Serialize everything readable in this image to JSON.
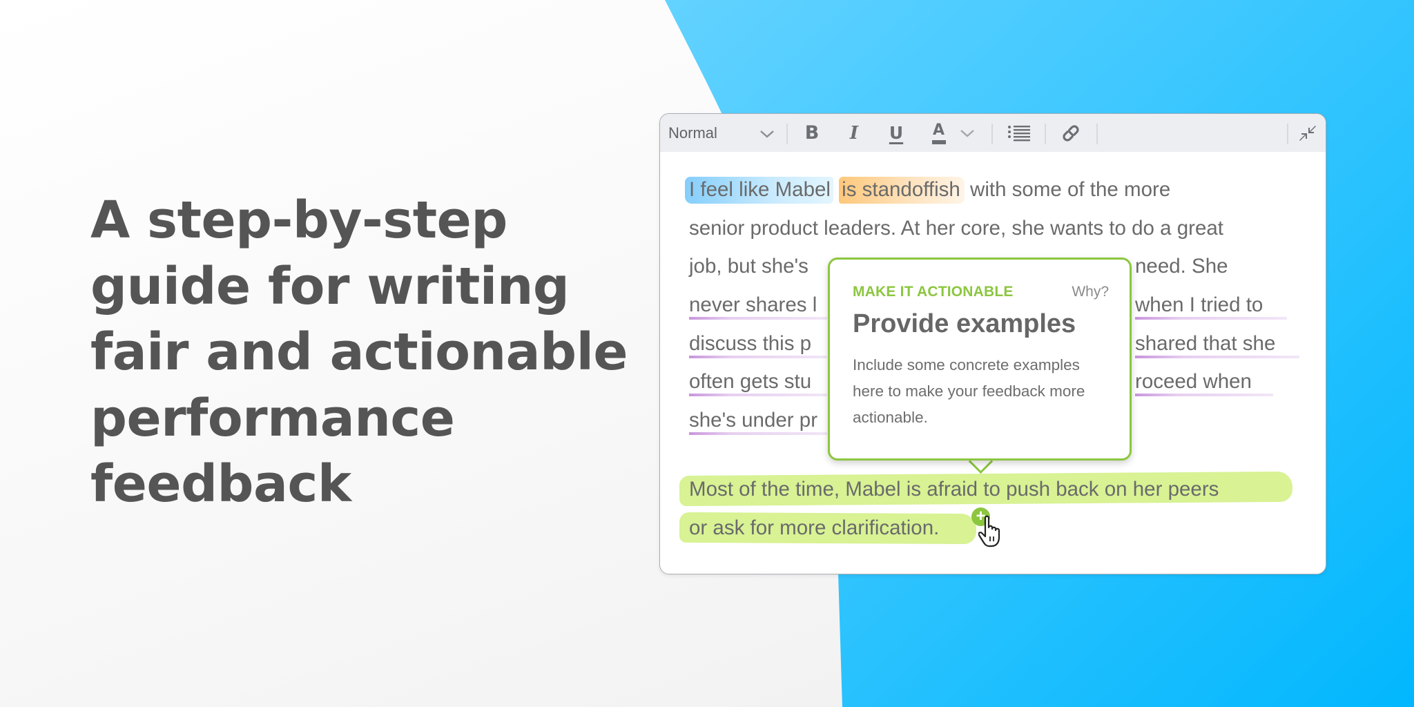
{
  "headline": {
    "lines": [
      "A step-by-step",
      "guide for writing",
      "fair and actionable",
      "performance",
      "feedback"
    ]
  },
  "colors": {
    "background_blue": "#1ec0ff",
    "headline_text": "#555555",
    "popover_accent": "#8cc63f",
    "highlight_blue": "#5cbefa",
    "highlight_orange": "#fdbe64",
    "highlight_green": "#d8f294",
    "underline_purple": "#be82d7"
  },
  "editor": {
    "toolbar": {
      "format_select": {
        "value": "Normal",
        "icon": "chevron-down-icon"
      },
      "buttons": [
        {
          "name": "bold",
          "label": "B",
          "icon": "bold-icon"
        },
        {
          "name": "italic",
          "label": "I",
          "icon": "italic-icon"
        },
        {
          "name": "underline",
          "label": "U",
          "icon": "underline-icon"
        },
        {
          "name": "text-color",
          "label": "A",
          "icon": "text-color-icon"
        },
        {
          "name": "text-color-dropdown",
          "icon": "chevron-down-icon"
        },
        {
          "name": "bulleted-list",
          "icon": "list-icon"
        },
        {
          "name": "link",
          "icon": "link-icon"
        },
        {
          "name": "collapse",
          "icon": "collapse-icon"
        }
      ]
    },
    "paragraph1": {
      "line1": {
        "blue_highlight": "I feel like Mabel",
        "orange_highlight": "is standoffish",
        "rest": " with some of the more"
      },
      "line2": "senior product leaders. At her core, she wants to do a great",
      "line3": {
        "left": "job, but she's",
        "right_plain": "need. ",
        "right_underlined": "She"
      },
      "line4": {
        "left": "never shares l",
        "right": "when I tried to"
      },
      "line5": {
        "left": "discuss this p",
        "right": "shared that she"
      },
      "line6": {
        "left": "often gets stu",
        "right": "roceed when"
      },
      "line7": {
        "left": "she's under pr"
      }
    },
    "paragraph2": {
      "line1": "Most of the time, Mabel is afraid to push back on her peers",
      "line2": "or ask for more clarification."
    },
    "add_comment_icon": "plus-icon",
    "cursor_icon": "hand-pointer-icon"
  },
  "popover": {
    "kicker": "MAKE IT ACTIONABLE",
    "why_link": "Why?",
    "title": "Provide examples",
    "body": "Include some concrete examples here to make your feedback more actionable."
  }
}
